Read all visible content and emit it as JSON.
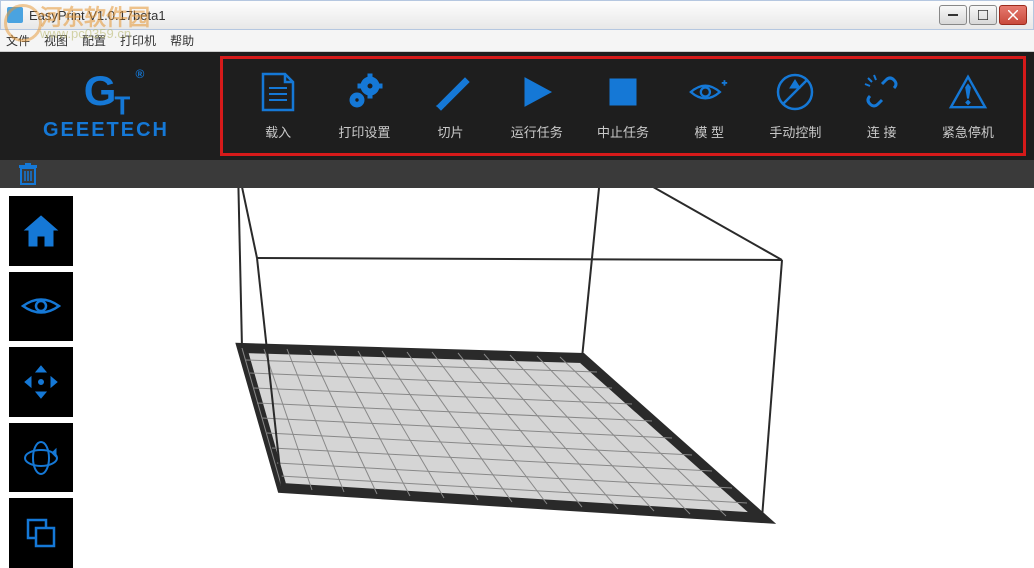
{
  "window": {
    "title": "EasyPrint   V1.0.17beta1"
  },
  "menu": {
    "file": "文件",
    "view": "视图",
    "config": "配置",
    "printer": "打印机",
    "help": "帮助"
  },
  "logo": {
    "brand": "GEEETECH"
  },
  "toolbar": {
    "load": "载入",
    "print_settings": "打印设置",
    "slice": "切片",
    "run_task": "运行任务",
    "stop_task": "中止任务",
    "model": "模 型",
    "manual_control": "手动控制",
    "connect": "连 接",
    "emergency_stop": "紧急停机"
  },
  "watermark": {
    "line1": "河东软件园",
    "line2": "www.pc0359.cn"
  },
  "colors": {
    "accent": "#1578d6",
    "highlight_border": "#d61a1a",
    "dark_bg": "#1e1e1e"
  }
}
